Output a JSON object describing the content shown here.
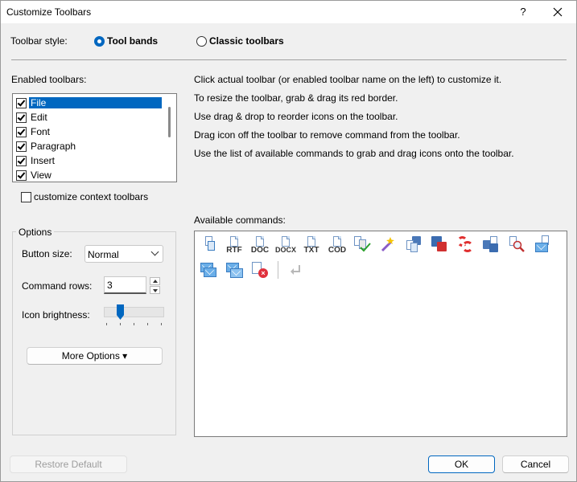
{
  "window": {
    "title": "Customize Toolbars",
    "help_label": "?",
    "close_label": "✕"
  },
  "toolbar_style": {
    "label": "Toolbar style:",
    "options": [
      {
        "label": "Tool bands",
        "selected": true
      },
      {
        "label": "Classic toolbars",
        "selected": false
      }
    ]
  },
  "enabled_toolbars": {
    "label": "Enabled toolbars:",
    "items": [
      {
        "label": "File",
        "checked": true,
        "selected": true
      },
      {
        "label": "Edit",
        "checked": true
      },
      {
        "label": "Font",
        "checked": true
      },
      {
        "label": "Paragraph",
        "checked": true
      },
      {
        "label": "Insert",
        "checked": true
      },
      {
        "label": "View",
        "checked": true
      }
    ]
  },
  "customize_context": {
    "label": "customize context toolbars",
    "checked": false
  },
  "instructions": [
    "Click actual toolbar (or enabled toolbar name on the left) to customize it.",
    "To resize the toolbar, grab & drag its red border.",
    "Use drag & drop to reorder icons on the toolbar.",
    "Drag icon off the toolbar to remove command from the toolbar.",
    "Use the list of available commands to grab and drag icons onto the toolbar."
  ],
  "options": {
    "legend": "Options",
    "button_size": {
      "label": "Button size:",
      "value": "Normal"
    },
    "command_rows": {
      "label": "Command rows:",
      "value": "3"
    },
    "icon_brightness": {
      "label": "Icon brightness:",
      "level": 0.25
    },
    "more_options_label": "More Options ▾"
  },
  "available_commands": {
    "label": "Available commands:",
    "format_labels": [
      "RTF",
      "DOC",
      "DOCX",
      "TXT",
      "COD"
    ],
    "icons": [
      "new-document-icon",
      "save-rtf-icon",
      "save-doc-icon",
      "save-docx-icon",
      "save-txt-icon",
      "save-cod-icon",
      "check-document-icon",
      "magic-wand-icon",
      "save-copy-icon",
      "save-disk-icon",
      "lifebuoy-icon",
      "save-all-icon",
      "find-document-icon",
      "send-mail-icon",
      "email-icon",
      "forward-mail-icon",
      "close-document-icon",
      "line-break-icon"
    ]
  },
  "footer": {
    "restore_label": "Restore Default",
    "ok_label": "OK",
    "cancel_label": "Cancel"
  },
  "colors": {
    "accent": "#0067c0",
    "background": "#f0f0f0"
  }
}
